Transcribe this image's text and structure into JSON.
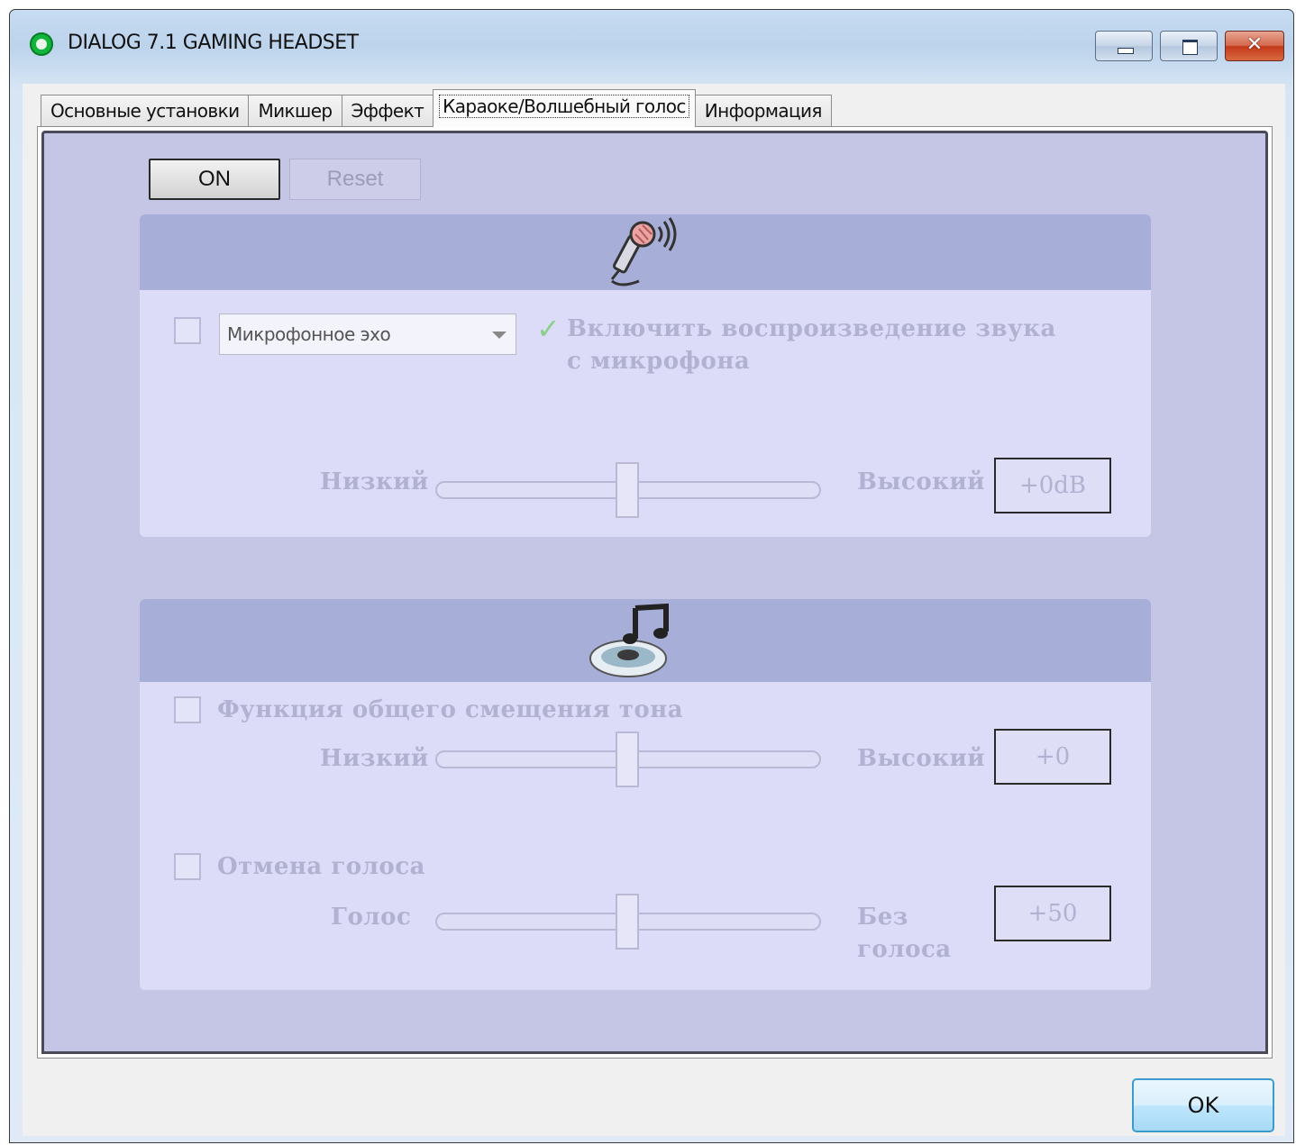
{
  "window": {
    "title": "DIALOG 7.1 GAMING HEADSET",
    "controls": {
      "minimize": "minimize",
      "maximize": "maximize",
      "close": "✕"
    }
  },
  "tabs": [
    {
      "label": "Основные установки",
      "active": false
    },
    {
      "label": "Микшер",
      "active": false
    },
    {
      "label": "Эффект",
      "active": false
    },
    {
      "label": "Караоке/Волшебный голос",
      "active": true
    },
    {
      "label": "Информация",
      "active": false
    }
  ],
  "toolbar": {
    "on_label": "ON",
    "reset_label": "Reset"
  },
  "mic_panel": {
    "icon": "microphone-icon",
    "enabled": false,
    "effect_select": {
      "value": "Микрофонное эхо"
    },
    "playback_check_line1": "Включить воспроизведение звука",
    "playback_check_line2": "с микрофона",
    "slider": {
      "min_label": "Низкий",
      "max_label": "Высокий",
      "value_text": "+0dB",
      "position": 0.5
    }
  },
  "music_panel": {
    "icon": "music-disc-icon",
    "pitch": {
      "label": "Функция общего смещения тона",
      "enabled": false,
      "slider": {
        "min_label": "Низкий",
        "max_label": "Высокий",
        "value_text": "+0",
        "position": 0.5
      }
    },
    "voice_cancel": {
      "label": "Отмена голоса",
      "enabled": false,
      "slider": {
        "min_label": "Голос",
        "max_label_line1": "Без",
        "max_label_line2": "голоса",
        "value_text": "+50",
        "position": 0.5
      }
    }
  },
  "footer": {
    "ok_label": "OK"
  },
  "colors": {
    "pane_background": "#c5c5e5",
    "panel_header": "#a7aed8",
    "panel_body": "#dcdcf8",
    "disabled_text": "#b1b1d1",
    "app_icon": "#11b53b"
  }
}
